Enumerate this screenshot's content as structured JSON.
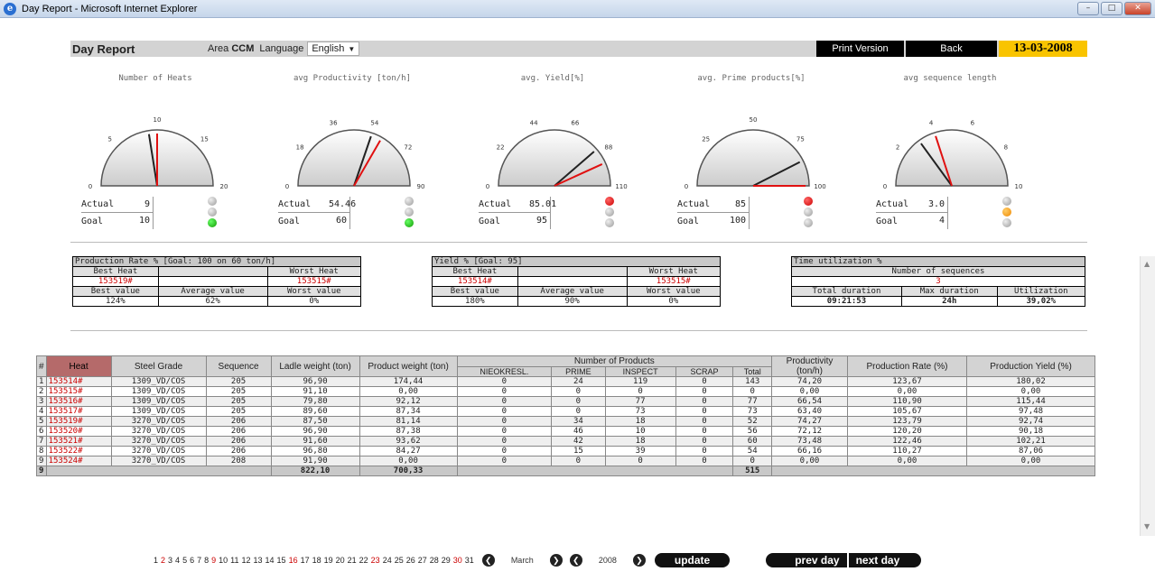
{
  "window": {
    "title": "Day Report - Microsoft Internet Explorer"
  },
  "header": {
    "title": "Day Report",
    "area_label": "Area",
    "area_value": "CCM",
    "language_label": "Language",
    "language_value": "English",
    "print_label": "Print Version",
    "back_label": "Back",
    "date": "13-03-2008"
  },
  "gauges": [
    {
      "title": "Number of Heats",
      "ticks": [
        "0",
        "5",
        "10",
        "15",
        "20"
      ],
      "actual_label": "Actual",
      "actual": "9",
      "goal_label": "Goal",
      "goal": "10",
      "lights": [
        "off",
        "off",
        "green"
      ],
      "max": 20,
      "actual_val": 9,
      "goal_val": 10
    },
    {
      "title": "avg Productivity [ton/h]",
      "ticks": [
        "0",
        "18",
        "36",
        "54",
        "72",
        "90"
      ],
      "actual_label": "Actual",
      "actual": "54.46",
      "goal_label": "Goal",
      "goal": "60",
      "lights": [
        "off",
        "off",
        "green"
      ],
      "max": 90,
      "actual_val": 54.46,
      "goal_val": 60
    },
    {
      "title": "avg. Yield[%]",
      "ticks": [
        "0",
        "22",
        "44",
        "66",
        "88",
        "110"
      ],
      "actual_label": "Actual",
      "actual": "85.01",
      "goal_label": "Goal",
      "goal": "95",
      "lights": [
        "red",
        "off",
        "off"
      ],
      "max": 110,
      "actual_val": 85.01,
      "goal_val": 95
    },
    {
      "title": "avg. Prime products[%]",
      "ticks": [
        "0",
        "25",
        "50",
        "75",
        "100"
      ],
      "actual_label": "Actual",
      "actual": "85",
      "goal_label": "Goal",
      "goal": "100",
      "lights": [
        "red",
        "off",
        "off"
      ],
      "max": 100,
      "actual_val": 85,
      "goal_val": 100
    },
    {
      "title": "avg sequence length",
      "ticks": [
        "0",
        "2",
        "4",
        "6",
        "8",
        "10"
      ],
      "actual_label": "Actual",
      "actual": "3.0",
      "goal_label": "Goal",
      "goal": "4",
      "lights": [
        "off",
        "orange",
        "off"
      ],
      "max": 10,
      "actual_val": 3.0,
      "goal_val": 4
    }
  ],
  "summary_prod": {
    "title": "Production Rate % [Goal: 100 on 60 ton/h]",
    "best_heat_label": "Best Heat",
    "worst_heat_label": "Worst Heat",
    "best_heat": "153519#",
    "worst_heat": "153515#",
    "best_value_label": "Best value",
    "average_value_label": "Average value",
    "worst_value_label": "Worst value",
    "best_value": "124%",
    "average_value": "62%",
    "worst_value": "0%"
  },
  "summary_yield": {
    "title": "Yield % [Goal: 95]",
    "best_heat_label": "Best Heat",
    "worst_heat_label": "Worst Heat",
    "best_heat": "153514#",
    "worst_heat": "153515#",
    "best_value_label": "Best value",
    "average_value_label": "Average value",
    "worst_value_label": "Worst value",
    "best_value": "180%",
    "average_value": "90%",
    "worst_value": "0%"
  },
  "summary_time": {
    "title": "Time utilization %",
    "sequences_label": "Number of sequences",
    "sequences": "3",
    "total_label": "Total duration",
    "max_label": "Max duration",
    "util_label": "Utilization",
    "total": "09:21:53",
    "max": "24h",
    "util": "39,02%"
  },
  "table": {
    "headers": {
      "idx": "#",
      "heat": "Heat",
      "steel": "Steel Grade",
      "seq": "Sequence",
      "ladle": "Ladle weight (ton)",
      "product": "Product weight (ton)",
      "nprod": "Number of Products",
      "nieo": "NIEOKRESL.",
      "prime": "PRIME",
      "inspect": "INSPECT",
      "scrap": "SCRAP",
      "total": "Total",
      "productivity": "Productivity (ton/h)",
      "rate": "Production Rate (%)",
      "yield": "Production Yield (%)"
    },
    "rows": [
      [
        "1",
        "153514#",
        "1309_VD/COS",
        "205",
        "96,90",
        "174,44",
        "0",
        "24",
        "119",
        "0",
        "143",
        "74,20",
        "123,67",
        "180,02"
      ],
      [
        "2",
        "153515#",
        "1309_VD/COS",
        "205",
        "91,10",
        "0,00",
        "0",
        "0",
        "0",
        "0",
        "0",
        "0,00",
        "0,00",
        "0,00"
      ],
      [
        "3",
        "153516#",
        "1309_VD/COS",
        "205",
        "79,80",
        "92,12",
        "0",
        "0",
        "77",
        "0",
        "77",
        "66,54",
        "110,90",
        "115,44"
      ],
      [
        "4",
        "153517#",
        "1309_VD/COS",
        "205",
        "89,60",
        "87,34",
        "0",
        "0",
        "73",
        "0",
        "73",
        "63,40",
        "105,67",
        "97,48"
      ],
      [
        "5",
        "153519#",
        "3270_VD/COS",
        "206",
        "87,50",
        "81,14",
        "0",
        "34",
        "18",
        "0",
        "52",
        "74,27",
        "123,79",
        "92,74"
      ],
      [
        "6",
        "153520#",
        "3270_VD/COS",
        "206",
        "96,90",
        "87,38",
        "0",
        "46",
        "10",
        "0",
        "56",
        "72,12",
        "120,20",
        "90,18"
      ],
      [
        "7",
        "153521#",
        "3270_VD/COS",
        "206",
        "91,60",
        "93,62",
        "0",
        "42",
        "18",
        "0",
        "60",
        "73,48",
        "122,46",
        "102,21"
      ],
      [
        "8",
        "153522#",
        "3270_VD/COS",
        "206",
        "96,80",
        "84,27",
        "0",
        "15",
        "39",
        "0",
        "54",
        "66,16",
        "110,27",
        "87,06"
      ],
      [
        "9",
        "153524#",
        "3270_VD/COS",
        "208",
        "91,90",
        "0,00",
        "0",
        "0",
        "0",
        "0",
        "0",
        "0,00",
        "0,00",
        "0,00"
      ]
    ],
    "total_row": {
      "idx": "9",
      "ladle": "822,10",
      "product": "700,33",
      "total": "515"
    }
  },
  "pager": {
    "days": [
      "1",
      "2",
      "3",
      "4",
      "5",
      "6",
      "7",
      "8",
      "9",
      "10",
      "11",
      "12",
      "13",
      "14",
      "15",
      "16",
      "17",
      "18",
      "19",
      "20",
      "21",
      "22",
      "23",
      "24",
      "25",
      "26",
      "27",
      "28",
      "29",
      "30",
      "31"
    ],
    "weekend_days": [
      "2",
      "9",
      "16",
      "23",
      "30"
    ],
    "month": "March",
    "year": "2008",
    "update_label": "update",
    "prev_label": "prev day",
    "next_label": "next day"
  }
}
